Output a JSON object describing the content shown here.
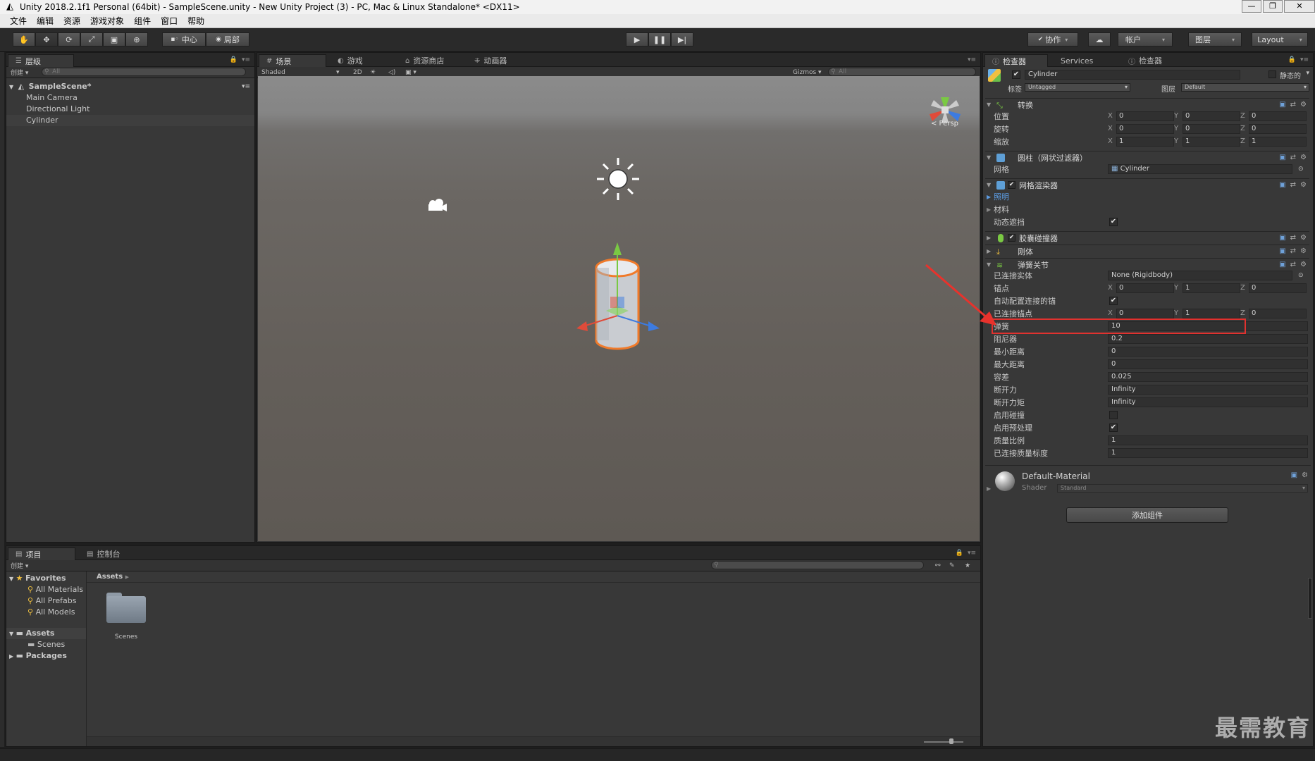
{
  "window": {
    "title": "Unity 2018.2.1f1 Personal (64bit) - SampleScene.unity - New Unity Project (3) - PC, Mac & Linux Standalone* <DX11>",
    "buttons": [
      "—",
      "❐",
      "✕"
    ]
  },
  "menu": [
    "文件",
    "编辑",
    "资源",
    "游戏对象",
    "组件",
    "窗口",
    "帮助"
  ],
  "toolbar": {
    "pivot": "中心",
    "space": "局部",
    "collab": "协作",
    "account": "帐户",
    "layers": "图层",
    "layout": "Layout"
  },
  "hierarchy": {
    "tab": "层级",
    "create": "创建",
    "search_placeholder": "All",
    "scene": "SampleScene*",
    "items": [
      "Main Camera",
      "Directional Light",
      "Cylinder"
    ]
  },
  "scene": {
    "tabs": [
      "场景",
      "游戏",
      "资源商店",
      "动画器"
    ],
    "shading": "Shaded",
    "mode_2d": "2D",
    "gizmos": "Gizmos",
    "search_placeholder": "All",
    "persp": "Persp"
  },
  "inspector": {
    "tabs": [
      "检查器",
      "Services",
      "检查器"
    ],
    "object_name": "Cylinder",
    "static_label": "静态的",
    "tag_label": "标签",
    "tag_value": "Untagged",
    "layer_label": "图层",
    "layer_value": "Default",
    "transform": {
      "title": "转换",
      "position_label": "位置",
      "position": [
        "0",
        "0",
        "0"
      ],
      "rotation_label": "旋转",
      "rotation": [
        "0",
        "0",
        "0"
      ],
      "scale_label": "缩放",
      "scale": [
        "1",
        "1",
        "1"
      ]
    },
    "mesh_filter": {
      "title": "圆柱（网状过滤器）",
      "mesh_label": "网格",
      "mesh_value": "Cylinder"
    },
    "mesh_renderer": {
      "title": "网格渲染器",
      "lighting_label": "照明",
      "materials_label": "材料",
      "dynamic_occluded_label": "动态遮挡"
    },
    "capsule_collider": {
      "title": "胶囊碰撞器"
    },
    "rigidbody": {
      "title": "刚体"
    },
    "spring_joint": {
      "title": "弹簧关节",
      "connected_body_label": "已连接实体",
      "connected_body_value": "None (Rigidbody)",
      "anchor_label": "锚点",
      "anchor": [
        "0",
        "1",
        "0"
      ],
      "auto_config_label": "自动配置连接的锚",
      "connected_anchor_label": "已连接锚点",
      "connected_anchor": [
        "0",
        "1",
        "0"
      ],
      "spring_label": "弹簧",
      "spring_value": "10",
      "damper_label": "阻尼器",
      "damper_value": "0.2",
      "min_distance_label": "最小距离",
      "min_distance_value": "0",
      "max_distance_label": "最大距离",
      "max_distance_value": "0",
      "tolerance_label": "容差",
      "tolerance_value": "0.025",
      "break_force_label": "断开力",
      "break_force_value": "Infinity",
      "break_torque_label": "断开力矩",
      "break_torque_value": "Infinity",
      "enable_collision_label": "启用碰撞",
      "enable_preprocessing_label": "启用预处理",
      "mass_scale_label": "质量比例",
      "mass_scale_value": "1",
      "connected_mass_scale_label": "已连接质量标度",
      "connected_mass_scale_value": "1"
    },
    "material": {
      "name": "Default-Material",
      "shader_label": "Shader",
      "shader_value": "Standard"
    },
    "add_component": "添加组件"
  },
  "project": {
    "tabs": [
      "项目",
      "控制台"
    ],
    "create": "创建",
    "favorites": "Favorites",
    "favorite_items": [
      "All Materials",
      "All Prefabs",
      "All Models"
    ],
    "assets": "Assets",
    "asset_children": [
      "Scenes"
    ],
    "packages": "Packages",
    "breadcrumb": "Assets",
    "folder_name": "Scenes"
  },
  "watermark": "最需教育",
  "colors": {
    "highlight_box": "#e0322f",
    "arrow": "#e8322c",
    "selection_outline": "#f07a2a"
  }
}
